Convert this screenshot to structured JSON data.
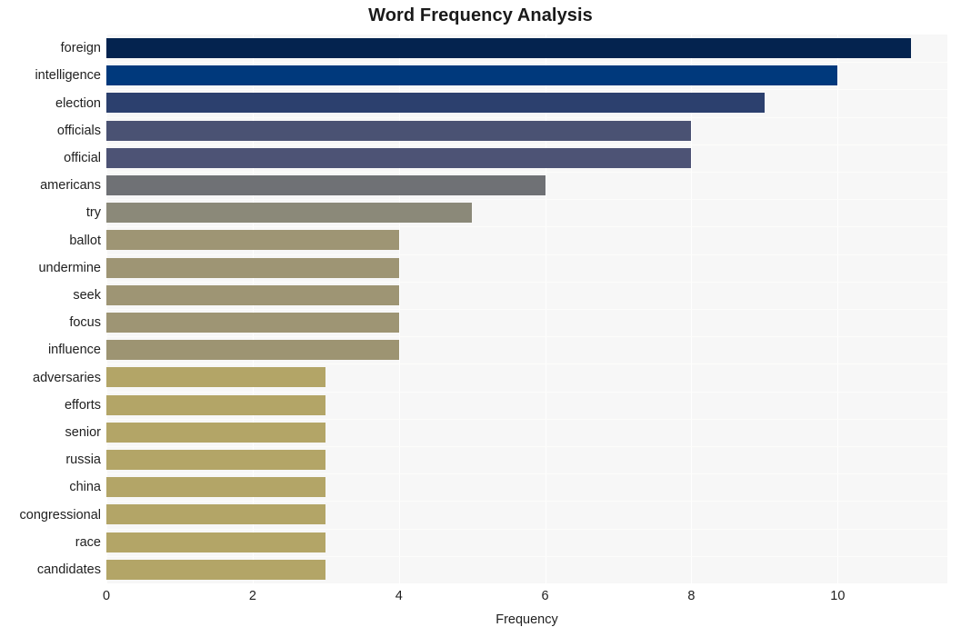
{
  "chart_data": {
    "type": "bar",
    "orientation": "horizontal",
    "title": "Word Frequency Analysis",
    "xlabel": "Frequency",
    "ylabel": "",
    "xlim": [
      0,
      11.5
    ],
    "xticks": [
      0,
      2,
      4,
      6,
      8,
      10
    ],
    "grid": true,
    "legend": null,
    "categories": [
      "foreign",
      "intelligence",
      "election",
      "officials",
      "official",
      "americans",
      "try",
      "ballot",
      "undermine",
      "seek",
      "focus",
      "influence",
      "adversaries",
      "efforts",
      "senior",
      "russia",
      "china",
      "congressional",
      "race",
      "candidates"
    ],
    "values": [
      11,
      10,
      9,
      8,
      8,
      6,
      5,
      4,
      4,
      4,
      4,
      4,
      3,
      3,
      3,
      3,
      3,
      3,
      3,
      3
    ],
    "bar_colors": [
      "#04234f",
      "#00397c",
      "#2c406e",
      "#4a5273",
      "#4d5375",
      "#6f7175",
      "#8b8979",
      "#9e9574",
      "#9e9574",
      "#9e9574",
      "#9e9574",
      "#9d9472",
      "#b3a567",
      "#b3a567",
      "#b3a567",
      "#b3a567",
      "#b3a567",
      "#b3a567",
      "#b3a567",
      "#b3a567"
    ],
    "plot_background": "#f7f7f7",
    "figure_background": "#ffffff",
    "gridline_color": "#ffffff"
  }
}
